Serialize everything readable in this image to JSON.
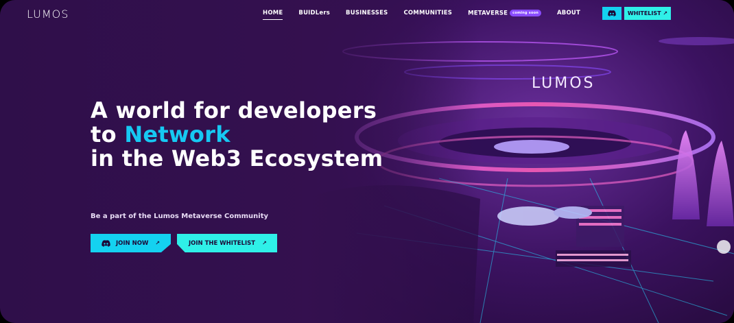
{
  "brand": {
    "logo_text": "LUMOS",
    "scene_logo_text": "LUMOS"
  },
  "nav": {
    "items": [
      {
        "label": "HOME",
        "active": true
      },
      {
        "label": "BUIDLers"
      },
      {
        "label": "BUSINESSES"
      },
      {
        "label": "COMMUNITIES"
      },
      {
        "label": "METAVERSE",
        "badge": "coming soon"
      },
      {
        "label": "ABOUT"
      }
    ],
    "discord_icon": "discord-icon",
    "whitelist_label": "WHITELIST ↗"
  },
  "hero": {
    "line1": "A world for developers",
    "line2_prefix": "to ",
    "line2_accent": "Network",
    "line3": "in the Web3 Ecosystem",
    "tagline": "Be a part of the Lumos Metaverse Community",
    "join_label": "JOIN NOW",
    "join_arrow": "↗",
    "whitelist_label": "JOIN THE WHITELIST",
    "whitelist_arrow": "↗"
  },
  "colors": {
    "background": "#34104f",
    "accent": "#16c9f3",
    "button_primary": "#14d2f0",
    "button_secondary": "#2ff0e8",
    "badge": "#8a4cff"
  }
}
